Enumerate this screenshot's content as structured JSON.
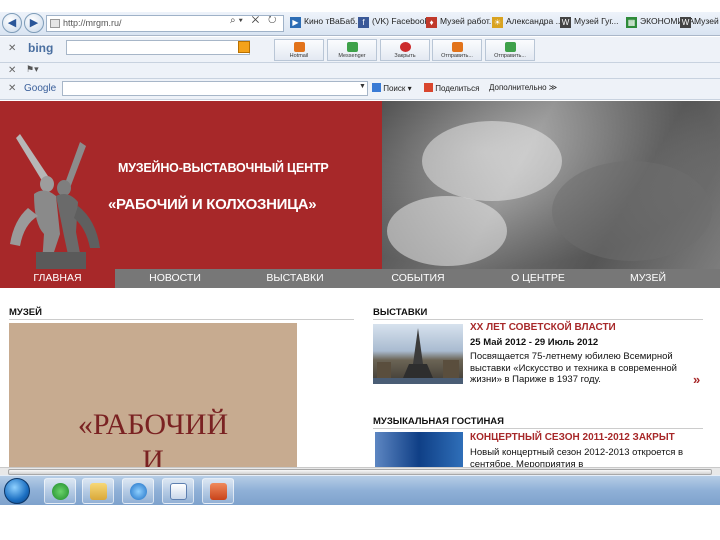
{
  "browser": {
    "url": "http://mrgm.ru/",
    "favorites": [
      {
        "label": "Кино тВаБаб...",
        "color": "#2d6db5",
        "glyph": "▶"
      },
      {
        "label": "(VK) Facebook",
        "color": "#3b5998",
        "glyph": "f"
      },
      {
        "label": "Музей работ...",
        "color": "#c0392b",
        "glyph": "♦"
      },
      {
        "label": "Александра ...",
        "color": "#d9a321",
        "glyph": "☀"
      },
      {
        "label": "Музей Гуг...",
        "color": "#444444",
        "glyph": "W"
      },
      {
        "label": "ЭКОНОМИКА...",
        "color": "#2e8b3a",
        "glyph": "▦"
      },
      {
        "label": "Музей ГА...",
        "color": "#444444",
        "glyph": "W"
      }
    ]
  },
  "bing_toolbar": {
    "logo": "bing",
    "buttons": [
      {
        "label": "Hotmail",
        "color": "#e2731b"
      },
      {
        "label": "Messenger",
        "color": "#3ea14a"
      },
      {
        "label": "Закрыть",
        "color": "#cc2b2b"
      },
      {
        "label": "Отправить...",
        "color": "#e2731b"
      },
      {
        "label": "Отправить...",
        "color": "#3ea14a"
      }
    ]
  },
  "google_toolbar": {
    "logo": "Google",
    "search_label": "Поиск",
    "share_label": "Поделиться",
    "more_label": "Дополнительно ≫"
  },
  "site": {
    "banner_line1": "МУЗЕЙНО-ВЫСТАВОЧНЫЙ ЦЕНТР",
    "banner_line2": "«РАБОЧИЙ И КОЛХОЗНИЦА»",
    "nav": [
      "ГЛАВНАЯ",
      "НОВОСТИ",
      "ВЫСТАВКИ",
      "СОБЫТИЯ",
      "О ЦЕНТРЕ",
      "МУЗЕЙ"
    ],
    "museum": {
      "title": "МУЗЕЙ",
      "line1": "«РАБОЧИЙ",
      "line2": "И"
    },
    "exhibitions": {
      "title": "ВЫСТАВКИ",
      "item_title": "XX ЛЕТ СОВЕТСКОЙ ВЛАСТИ",
      "item_date": "25 Май 2012 - 29 Июль 2012",
      "item_desc": "Посвящается 75-летнему юбилею Всемирной выставки «Искусство и техника в современной жизни» в Париже в 1937 году.",
      "more": "»"
    },
    "music": {
      "title": "МУЗЫКАЛЬНАЯ ГОСТИНАЯ",
      "item_title": "КОНЦЕРТНЫЙ СЕЗОН 2011-2012 ЗАКРЫТ",
      "item_desc": "Новый концертный сезон 2012-2013 откроется в сентябре. Мероприятия в"
    }
  }
}
